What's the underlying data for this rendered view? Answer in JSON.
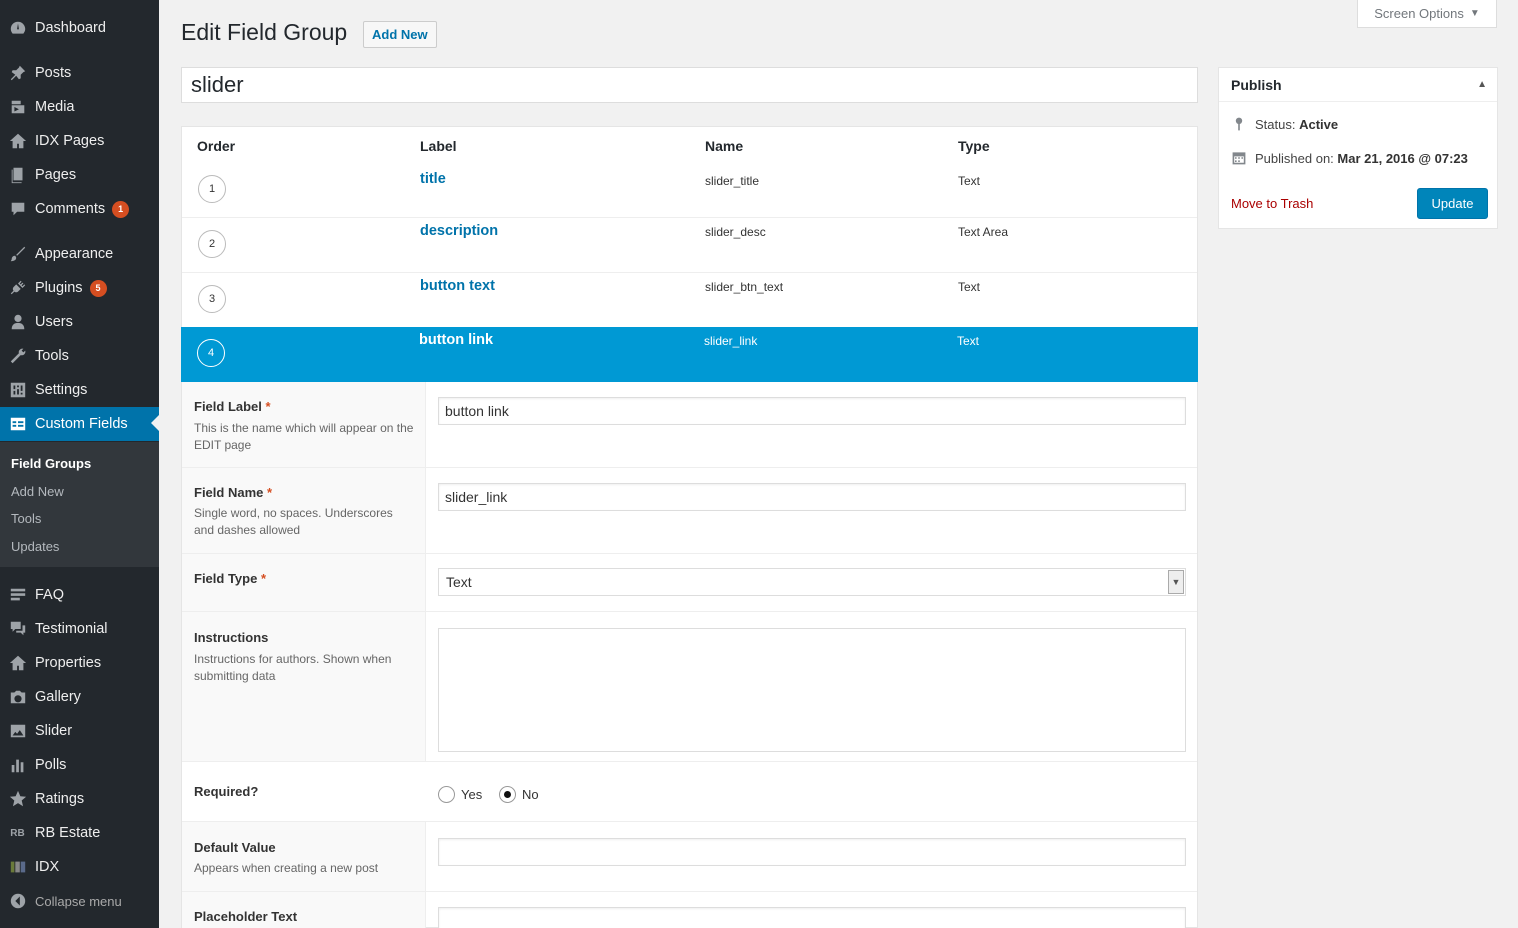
{
  "sidebar": {
    "items": [
      {
        "label": "Dashboard",
        "icon": "dashboard-icon"
      },
      {
        "label": "Posts",
        "icon": "pin-icon"
      },
      {
        "label": "Media",
        "icon": "media-icon"
      },
      {
        "label": "IDX Pages",
        "icon": "home-icon"
      },
      {
        "label": "Pages",
        "icon": "pages-icon"
      },
      {
        "label": "Comments",
        "icon": "comment-icon",
        "badge": "1"
      },
      {
        "label": "Appearance",
        "icon": "brush-icon"
      },
      {
        "label": "Plugins",
        "icon": "plug-icon",
        "badge": "5"
      },
      {
        "label": "Users",
        "icon": "user-icon"
      },
      {
        "label": "Tools",
        "icon": "wrench-icon"
      },
      {
        "label": "Settings",
        "icon": "sliders-icon"
      },
      {
        "label": "Custom Fields",
        "icon": "table-icon"
      },
      {
        "label": "FAQ",
        "icon": "list-icon"
      },
      {
        "label": "Testimonial",
        "icon": "comments-icon"
      },
      {
        "label": "Properties",
        "icon": "home-icon"
      },
      {
        "label": "Gallery",
        "icon": "camera-icon"
      },
      {
        "label": "Slider",
        "icon": "image-icon"
      },
      {
        "label": "Polls",
        "icon": "chart-icon"
      },
      {
        "label": "Ratings",
        "icon": "star-icon"
      },
      {
        "label": "RB Estate",
        "icon": "rb-text-icon",
        "icon_text": "RB"
      },
      {
        "label": "IDX",
        "icon": "idx-logo-icon"
      },
      {
        "label": "Collapse menu",
        "icon": "collapse-icon"
      }
    ],
    "submenu": [
      "Field Groups",
      "Add New",
      "Tools",
      "Updates"
    ]
  },
  "header": {
    "title": "Edit Field Group",
    "add_new": "Add New",
    "screen_options": "Screen Options"
  },
  "group_title": "slider",
  "fields_table": {
    "headers": [
      "Order",
      "Label",
      "Name",
      "Type"
    ],
    "rows": [
      {
        "order": "1",
        "label": "title",
        "name": "slider_title",
        "type": "Text"
      },
      {
        "order": "2",
        "label": "description",
        "name": "slider_desc",
        "type": "Text Area"
      },
      {
        "order": "3",
        "label": "button text",
        "name": "slider_btn_text",
        "type": "Text"
      },
      {
        "order": "4",
        "label": "button link",
        "name": "slider_link",
        "type": "Text"
      }
    ]
  },
  "field_settings": {
    "field_label": {
      "label": "Field Label",
      "req": "*",
      "desc": "This is the name which will appear on the EDIT page",
      "value": "button link"
    },
    "field_name": {
      "label": "Field Name",
      "req": "*",
      "desc": "Single word, no spaces. Underscores and dashes allowed",
      "value": "slider_link"
    },
    "field_type": {
      "label": "Field Type",
      "req": "*",
      "value": "Text"
    },
    "instructions": {
      "label": "Instructions",
      "desc": "Instructions for authors. Shown when submitting data",
      "value": ""
    },
    "required": {
      "label": "Required?",
      "yes": "Yes",
      "no": "No",
      "selected": "No"
    },
    "default_value": {
      "label": "Default Value",
      "desc": "Appears when creating a new post",
      "value": ""
    },
    "placeholder": {
      "label": "Placeholder Text",
      "value": ""
    }
  },
  "publish": {
    "title": "Publish",
    "status_label": "Status:",
    "status_value": "Active",
    "published_label": "Published on:",
    "published_value": "Mar 21, 2016 @ 07:23",
    "trash": "Move to Trash",
    "update": "Update"
  },
  "colors": {
    "sidebar_bg": "#23282d",
    "accent": "#0073aa",
    "selected_row": "#0099d4",
    "badge": "#d54e21"
  }
}
